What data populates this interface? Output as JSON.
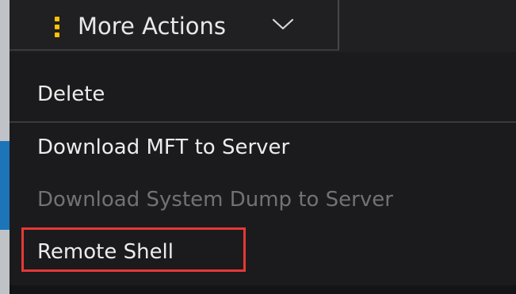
{
  "toolbar": {
    "more_actions_label": "More Actions",
    "more_actions_icon": "kebab-vertical-icon",
    "chevron_icon": "chevron-down-icon",
    "accent_color": "#ffc107"
  },
  "menu": {
    "items": [
      {
        "label": "Delete",
        "enabled": true
      },
      {
        "label": "Download MFT to Server",
        "enabled": true
      },
      {
        "label": "Download System Dump to Server",
        "enabled": false
      },
      {
        "label": "Remote Shell",
        "enabled": true,
        "highlighted": true
      }
    ],
    "highlight_color": "#e53935",
    "disabled_text_color": "#727276"
  }
}
